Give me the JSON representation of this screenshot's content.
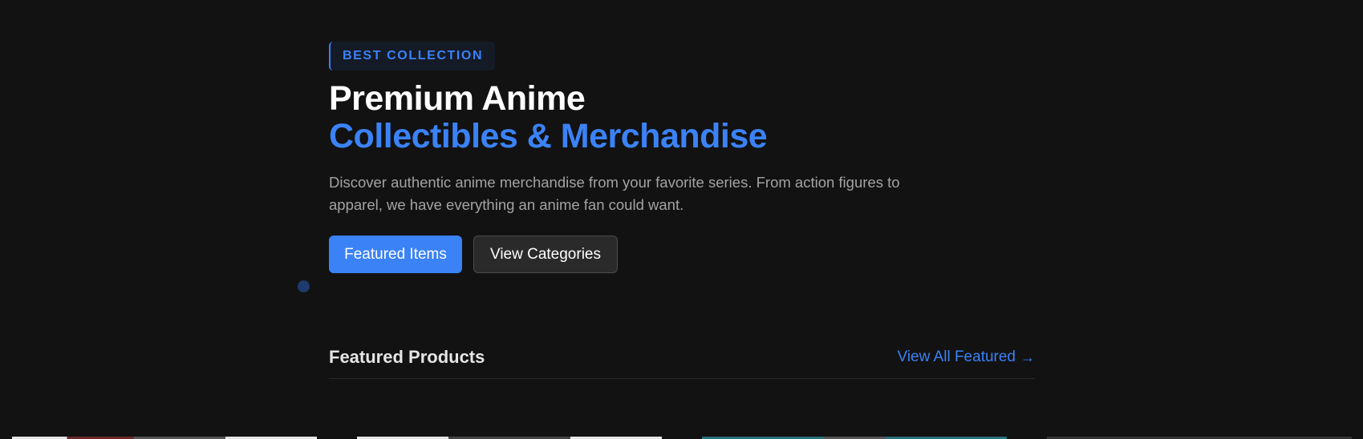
{
  "hero": {
    "badge": "BEST COLLECTION",
    "title_line1": "Premium Anime",
    "title_line2": "Collectibles & Merchandise",
    "description": "Discover authentic anime merchandise from your favorite series. From action figures to apparel, we have everything an anime fan could want.",
    "primary_button": "Featured Items",
    "secondary_button": "View Categories"
  },
  "featured": {
    "title": "Featured Products",
    "view_all": "View All Featured",
    "view_all_icon": "arrow-right-icon"
  },
  "colors": {
    "background": "#121212",
    "accent": "#3b82f6",
    "text_muted": "#a3a3a3"
  }
}
